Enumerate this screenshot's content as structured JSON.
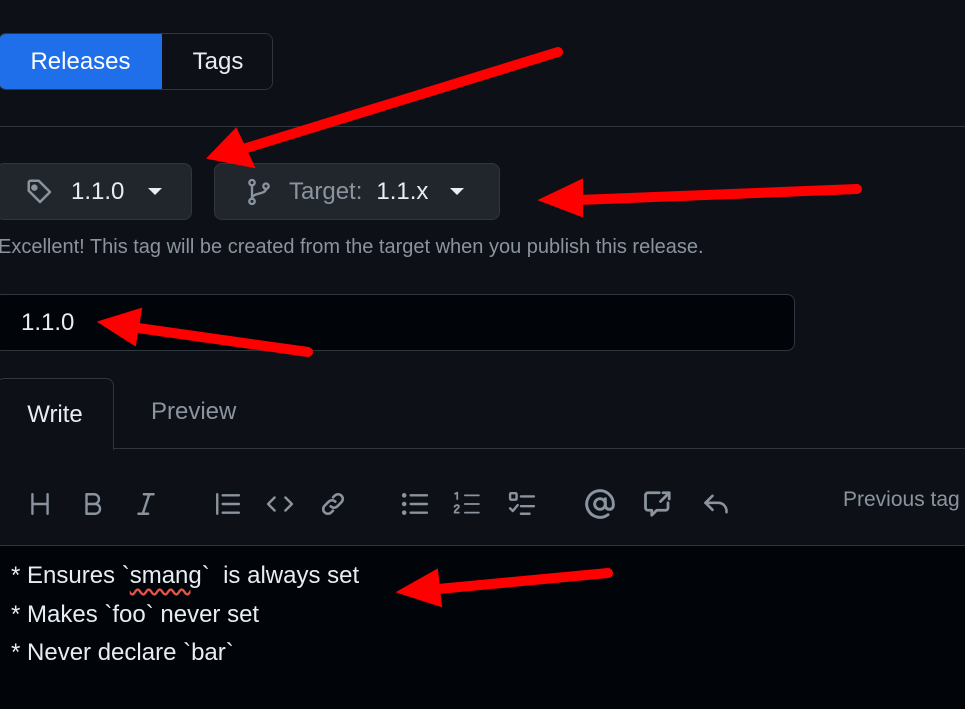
{
  "tabs": {
    "releases": "Releases",
    "tags": "Tags"
  },
  "tag_dropdown": {
    "value": "1.1.0",
    "icon": "tag-icon"
  },
  "target_dropdown": {
    "label": "Target:",
    "value": "1.1.x",
    "icon": "git-branch-icon"
  },
  "note": "Excellent! This tag will be created from the target when you publish this release.",
  "release_title": {
    "value": "1.1.0"
  },
  "editor_tabs": {
    "write": "Write",
    "preview": "Preview"
  },
  "toolbar": {
    "icons": [
      "heading-icon",
      "bold-icon",
      "italic-icon",
      "quote-icon",
      "code-icon",
      "link-icon",
      "unordered-list-icon",
      "ordered-list-icon",
      "task-list-icon",
      "mention-icon",
      "cross-reference-icon",
      "reply-icon"
    ],
    "previous_tag": "Previous tag"
  },
  "body": {
    "line1_prefix": "* Ensures `",
    "line1_word": "smang",
    "line1_suffix": "`  is always set",
    "line2": "* Makes `foo` never set",
    "line3": "* Never declare `bar`"
  },
  "colors": {
    "accent": "#1f6feb",
    "background": "#0d1117",
    "annotation_arrow": "#ff0000"
  }
}
